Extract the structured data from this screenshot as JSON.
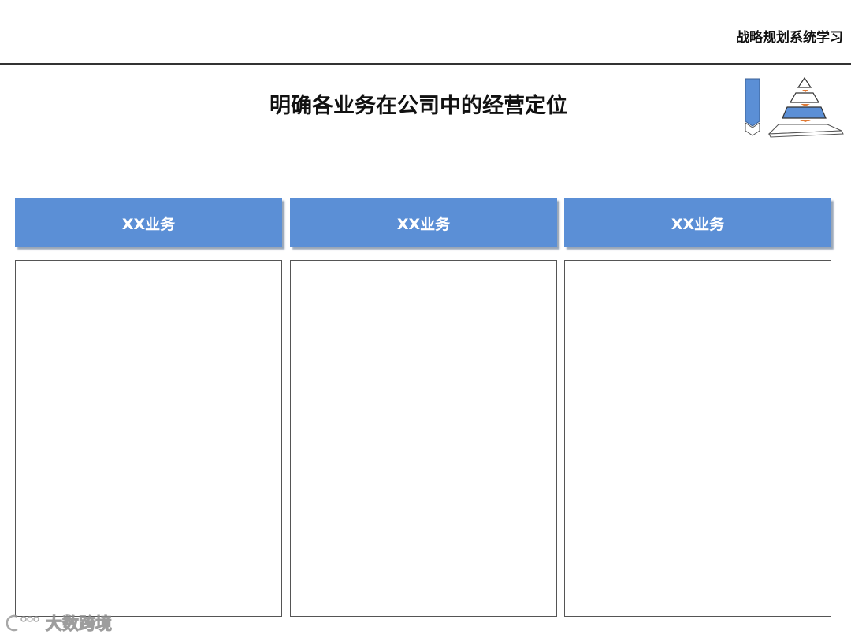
{
  "header": {
    "series_title": "战略规划系统学习"
  },
  "slide": {
    "title": "明确各业务在公司中的经营定位"
  },
  "columns": [
    {
      "title": "XX业务"
    },
    {
      "title": "XX业务"
    },
    {
      "title": "XX业务"
    }
  ],
  "watermark": {
    "text": "大数跨境"
  },
  "colors": {
    "header_blue": "#5b8fd6",
    "accent_orange": "#e07a35"
  }
}
